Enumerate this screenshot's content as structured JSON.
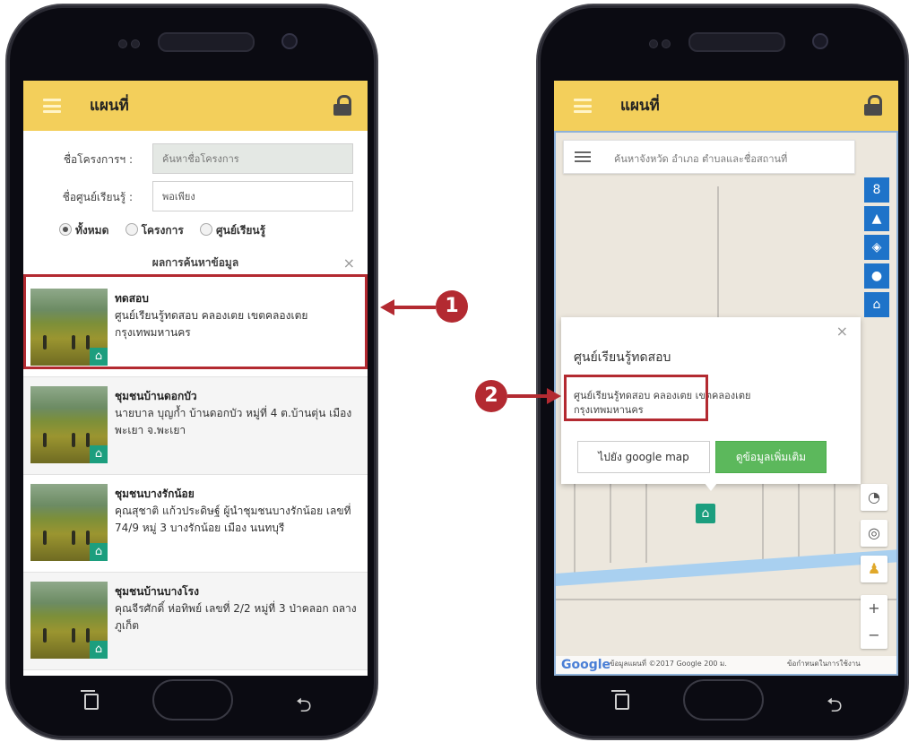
{
  "left_screen": {
    "app_title": "แผนที่",
    "form": {
      "project_label": "ชื่อโครงการฯ :",
      "project_placeholder": "ค้นหาชื่อโครงการ",
      "center_label": "ชื่อศูนย์เรียนรู้ :",
      "center_value": "พอเพียง"
    },
    "filters": [
      {
        "label": "ทั้งหมด",
        "checked": true
      },
      {
        "label": "โครงการ",
        "checked": false
      },
      {
        "label": "ศูนย์เรียนรู้",
        "checked": false
      }
    ],
    "results_title": "ผลการค้นหาข้อมูล",
    "results_close": "×",
    "results": [
      {
        "title": "ทดสอบ",
        "desc": "ศูนย์เรียนรู้ทดสอบ คลองเตย เขตคลองเตย กรุงเทพมหานคร"
      },
      {
        "title": "ชุมชนบ้านดอกบัว",
        "desc": "นายบาล บุญก้ำ บ้านดอกบัว หมู่ที่ 4 ต.บ้านตุ่น เมืองพะเยา จ.พะเยา"
      },
      {
        "title": "ชุมชนบางรักน้อย",
        "desc": "คุณสุชาติ แก้วประดิษฐ์ ผู้นำชุมชนบางรักน้อย เลขที่ 74/9 หมู่ 3 บางรักน้อย เมือง นนทบุรี"
      },
      {
        "title": "ชุมชนบ้านบางโรง",
        "desc": "คุณจีรศักดิ์ ห่อทิพย์ เลขที่ 2/2 หมู่ที่ 3 ป่าคลอก ถลาง ภูเก็ต"
      }
    ]
  },
  "right_screen": {
    "app_title": "แผนที่",
    "search_placeholder": "ค้นหาจังหวัด อำเภอ ตำบลและชื่อสถานที่",
    "popup": {
      "title": "ศูนย์เรียนรู้ทดสอบ",
      "desc": "ศูนย์เรียนรู้ทดสอบ คลองเตย เขตคลองเตย กรุงเทพมหานคร",
      "google_button": "ไปยัง google map",
      "more_button": "ดูข้อมูลเพิ่มเติม",
      "close": "×"
    },
    "map_attribution": "ข้อมูลแผนที่ ©2017 Google   200 ม.",
    "map_terms": "ข้อกำหนดในการใช้งาน",
    "google_logo": "Google",
    "zoom_in": "+",
    "zoom_out": "−"
  },
  "callouts": {
    "one": "1",
    "two": "2"
  },
  "colors": {
    "appbar": "#f3cf5b",
    "marker": "#1c9e7e",
    "callout": "#b32a31",
    "map_button": "#1e73c9",
    "more_button": "#5cb85c"
  },
  "icons": [
    "menu-icon",
    "lock-icon",
    "home-icon",
    "recent-apps-icon",
    "back-icon",
    "list-icon",
    "layers-icon",
    "globe-icon",
    "location-icon",
    "pegman-icon"
  ]
}
